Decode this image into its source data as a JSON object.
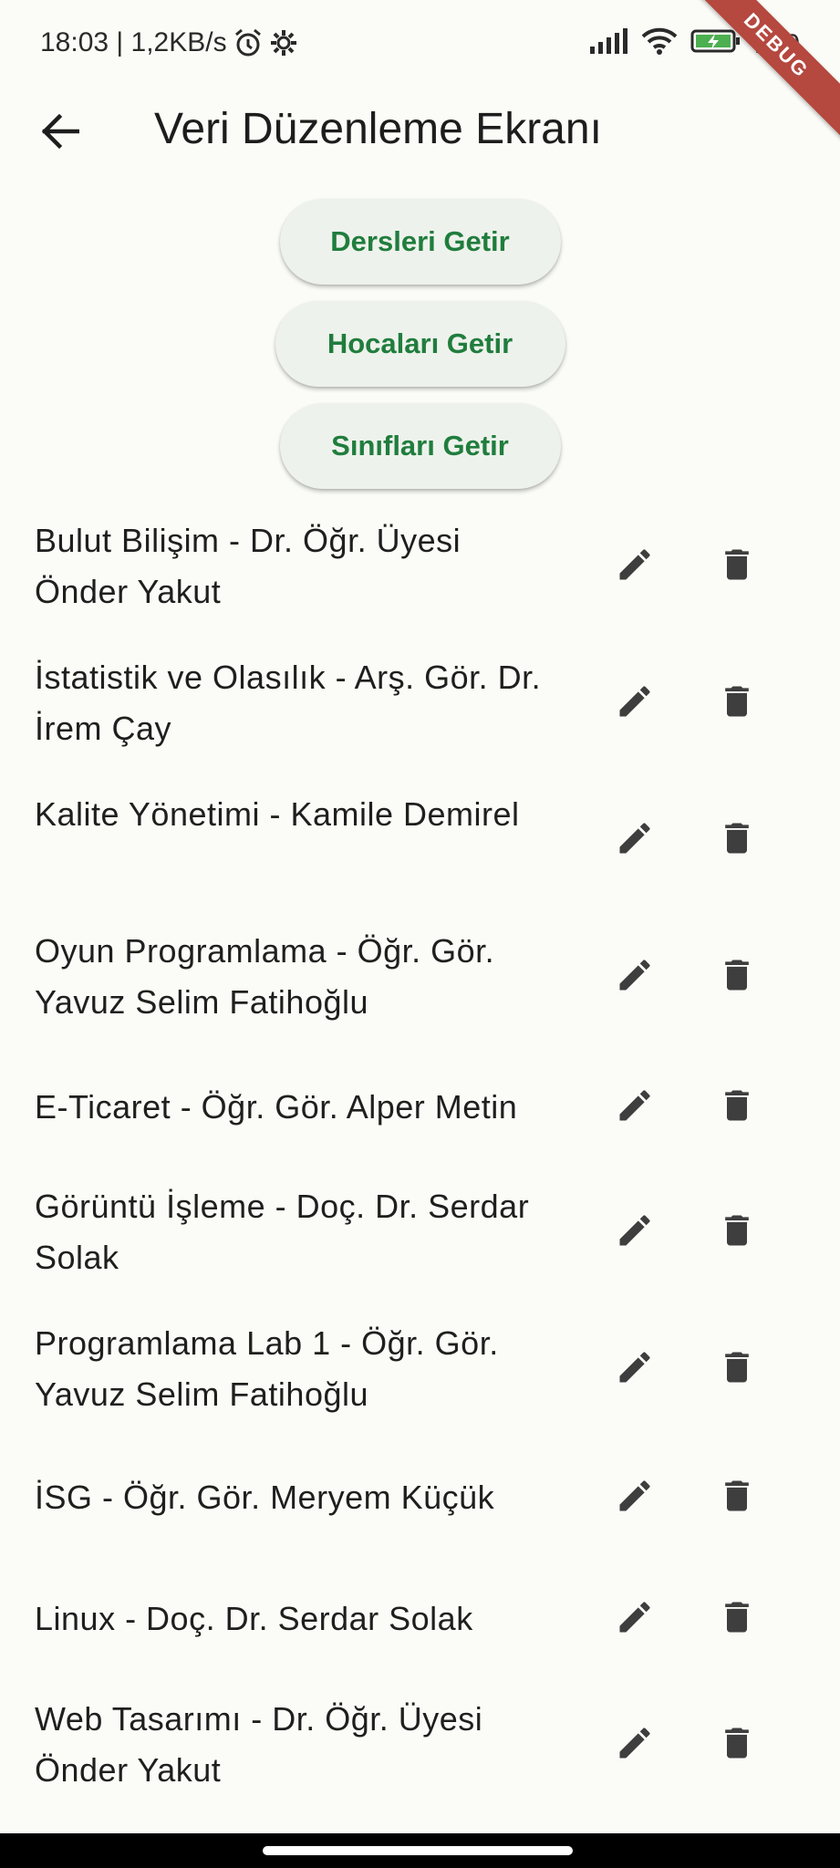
{
  "status_bar": {
    "time_speed": "18:03 | 1,2KB/s",
    "battery": "100"
  },
  "debug_banner": "DEBUG",
  "app_bar": {
    "title": "Veri Düzenleme Ekranı"
  },
  "buttons": {
    "courses": "Dersleri Getir",
    "teachers": "Hocaları Getir",
    "classes": "Sınıfları Getir"
  },
  "items": [
    "Bulut Bilişim - Dr. Öğr. Üyesi Önder Yakut",
    "İstatistik ve Olasılık - Arş. Gör. Dr. İrem Çay",
    "Kalite Yönetimi -   Kamile Demirel",
    "Oyun Programlama - Öğr. Gör. Yavuz Selim Fatihoğlu",
    "E-Ticaret - Öğr. Gör. Alper Metin",
    "Görüntü İşleme - Doç. Dr. Serdar Solak",
    "Programlama Lab 1 - Öğr. Gör. Yavuz Selim Fatihoğlu",
    "İSG - Öğr. Gör. Meryem Küçük",
    "Linux - Doç. Dr. Serdar Solak",
    "Web Tasarımı - Dr. Öğr. Üyesi Önder Yakut"
  ],
  "icons": {
    "edit": "edit-icon",
    "delete": "delete-icon",
    "back": "back-arrow-icon"
  },
  "colors": {
    "background": "#fbfcf7",
    "button_text": "#207d3d",
    "button_bg": "#eef2ec",
    "icon": "#3e3e3e",
    "debug_banner": "#b5483f"
  }
}
